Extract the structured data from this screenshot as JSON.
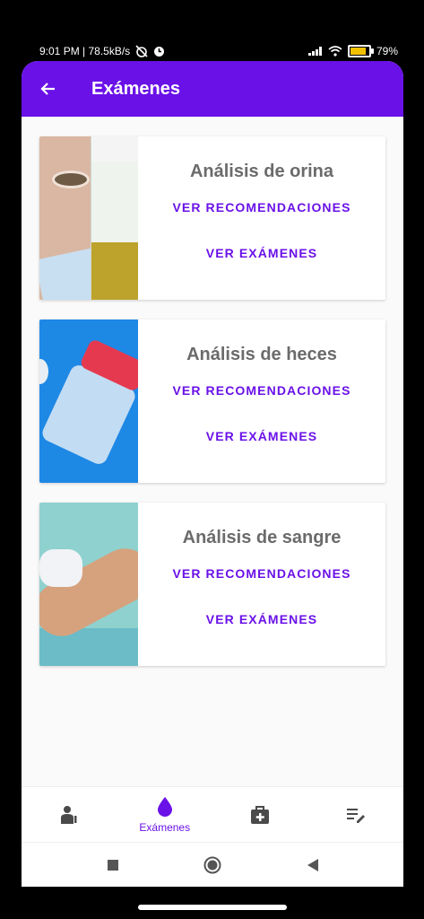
{
  "status_bar": {
    "time_speed": "9:01 PM | 78.5kB/s",
    "battery": "79%"
  },
  "app_bar": {
    "title": "Exámenes",
    "back_icon": "arrow-left-icon"
  },
  "cards": [
    {
      "title": "Análisis de orina",
      "link_recommendations": "VER RECOMENDACIONES",
      "link_exams": "VER EXÁMENES"
    },
    {
      "title": "Análisis de heces",
      "link_recommendations": "VER RECOMENDACIONES",
      "link_exams": "VER EXÁMENES"
    },
    {
      "title": "Análisis de sangre",
      "link_recommendations": "VER RECOMENDACIONES",
      "link_exams": "VER EXÁMENES"
    }
  ],
  "bottom_nav": {
    "items": [
      {
        "icon": "doctor-icon",
        "label": ""
      },
      {
        "icon": "blood-drop-icon",
        "label": "Exámenes",
        "active": true
      },
      {
        "icon": "medical-kit-icon",
        "label": ""
      },
      {
        "icon": "edit-list-icon",
        "label": ""
      }
    ]
  },
  "colors": {
    "primary": "#6a11e8",
    "title_text": "#6b6b6b",
    "background": "#fafafa"
  }
}
